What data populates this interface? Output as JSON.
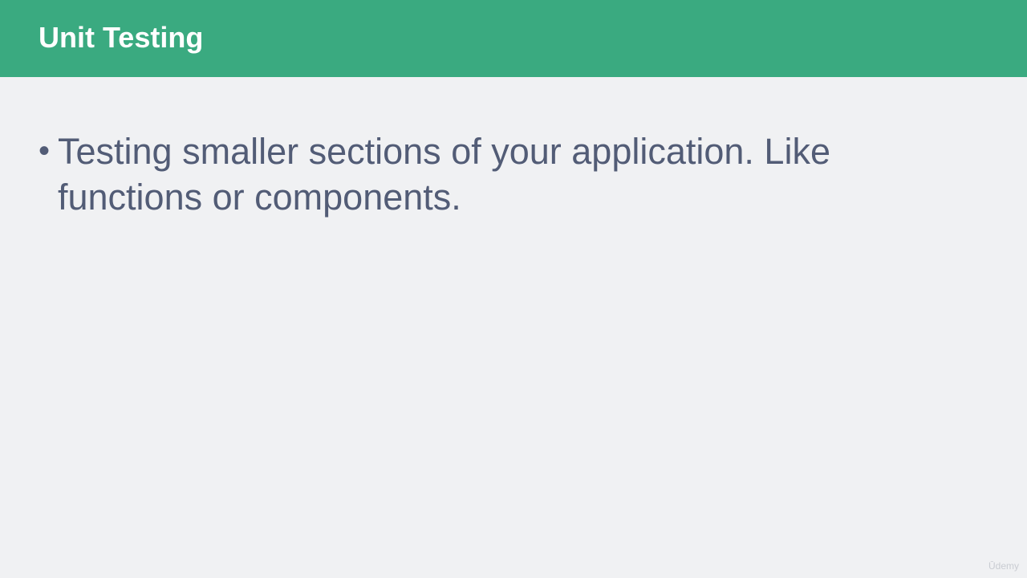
{
  "slide": {
    "title": "Unit Testing",
    "bullets": [
      {
        "marker": "•",
        "text": "Testing smaller sections of your application. Like functions or components."
      }
    ],
    "watermark": "Ūdemy"
  },
  "colors": {
    "header_background": "#3aaa80",
    "slide_background": "#f0f1f3",
    "title_text": "#ffffff",
    "body_text": "#525c76",
    "watermark_text": "#c9ccd2"
  }
}
